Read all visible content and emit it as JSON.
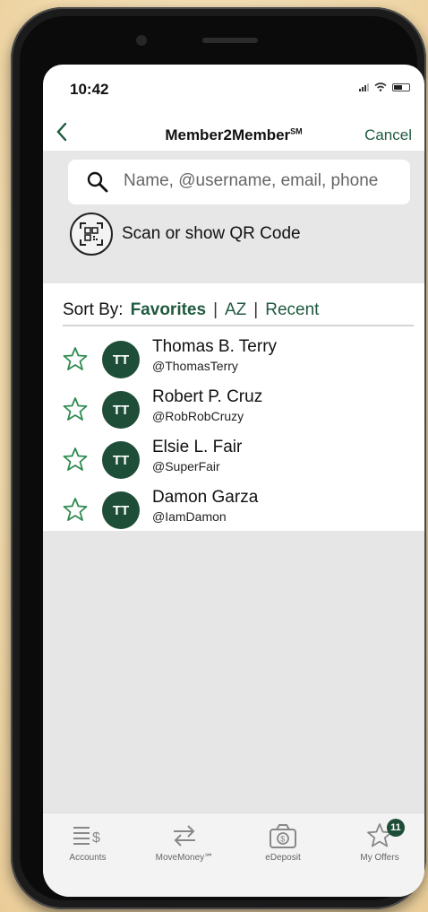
{
  "status": {
    "time": "10:42"
  },
  "nav": {
    "back_icon": "chevron-left-icon",
    "title": "Member2Member",
    "title_mark": "SM",
    "cancel_label": "Cancel"
  },
  "search": {
    "placeholder": "Name, @username, email, phone"
  },
  "qr": {
    "label": "Scan or show QR Code"
  },
  "sort": {
    "prefix": "Sort By:",
    "favorites": "Favorites",
    "az": "AZ",
    "recent": "Recent",
    "separator": "|"
  },
  "contacts": [
    {
      "initials": "TT",
      "name": "Thomas B. Terry",
      "username": "@ThomasTerry"
    },
    {
      "initials": "TT",
      "name": "Robert P. Cruz",
      "username": "@RobRobCruzy"
    },
    {
      "initials": "TT",
      "name": "Elsie L. Fair",
      "username": "@SuperFair"
    },
    {
      "initials": "TT",
      "name": "Damon Garza",
      "username": "@IamDamon"
    }
  ],
  "tabs": [
    {
      "label": "Accounts",
      "icon": "accounts-icon"
    },
    {
      "label": "MoveMoney℠",
      "icon": "transfer-arrows-icon"
    },
    {
      "label": "eDeposit",
      "icon": "camera-deposit-icon"
    },
    {
      "label": "My Offers",
      "icon": "star-icon",
      "badge": "11"
    }
  ],
  "colors": {
    "brand_green": "#1e4d38",
    "accent_green": "#1f5a3f",
    "background_cream": "#f3ddb0"
  }
}
